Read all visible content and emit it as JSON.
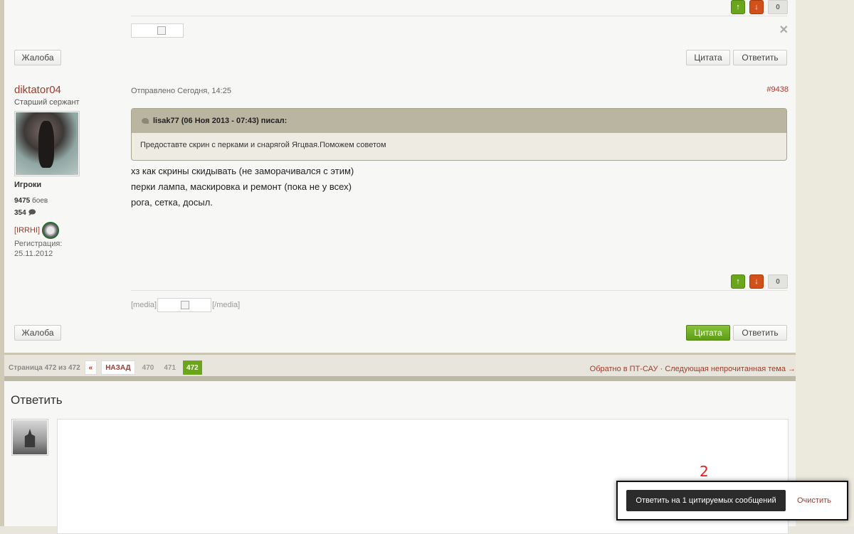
{
  "prev_post": {
    "vote_count": "0",
    "report_label": "Жалоба",
    "quote_label": "Цитата",
    "reply_label": "Ответить"
  },
  "post": {
    "author": "diktator04",
    "rank": "Старший сержант",
    "group": "Игроки",
    "battles_num": "9475",
    "battles_label": "боев",
    "posts_num": "354",
    "clan": "[IRRHI]",
    "reg_label": "Регистрация:",
    "reg_date": "25.11.2012",
    "posted": "Отправлено Сегодня, 14:25",
    "number": "#9438",
    "quote_author": "lisak77 (06 Ноя 2013 - 07:43) писал:",
    "quote_text": "Предоставте скрин с перками и снарягой Ягцвая.Поможем советом",
    "lines": [
      "хз как скрины скидывать (не заморачивался с этим)",
      "перки лампа, маскировка и ремонт (пока не у всех)",
      "рога, сетка, досыл."
    ],
    "media_open": "[media]",
    "media_close": "[/media]",
    "vote_count": "0",
    "report_label": "Жалоба",
    "quote_label": "Цитата",
    "reply_label": "Ответить"
  },
  "pager": {
    "label": "Страница 472 из 472",
    "first": "«",
    "back": "НАЗАД",
    "pages": [
      "470",
      "471"
    ],
    "current": "472",
    "back_link": "Обратно в ПТ-САУ",
    "sep": "·",
    "next_unread": "Следующая непрочитанная тема →"
  },
  "reply": {
    "title": "Ответить"
  },
  "annotation": "2",
  "multiquote": {
    "button": "Ответить на 1 цитируемых сообщений",
    "clear": "Очистить"
  },
  "colors": {
    "accent_red": "#a23a2b",
    "vote_up": "#6aa51c",
    "vote_down": "#d2501a",
    "quote_bg": "#b9b5a1"
  }
}
